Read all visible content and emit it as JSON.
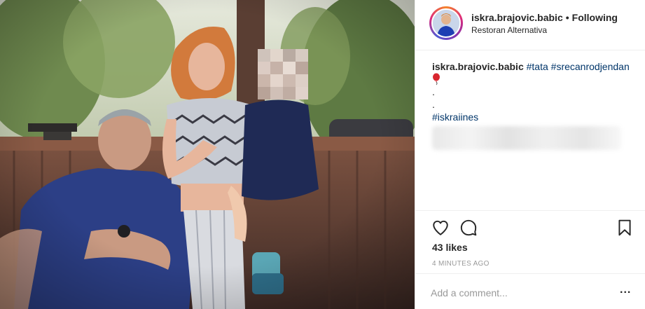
{
  "post": {
    "username": "iskra.brajovic.babic",
    "separator": "•",
    "follow_status": "Following",
    "location": "Restoran Alternativa"
  },
  "caption": {
    "username": "iskra.brajovic.babic",
    "hashtag_1": "#tata",
    "hashtag_2": "#srecanrodjendan",
    "emoji_icon": "balloon-icon",
    "dot_1": ".",
    "dot_2": ".",
    "hashtag_3": "#iskraiines"
  },
  "actions": {
    "like_icon": "heart-icon",
    "comment_icon": "speech-bubble-icon",
    "save_icon": "bookmark-icon"
  },
  "likes_text": "43 likes",
  "timestamp": "4 MINUTES AGO",
  "comment": {
    "placeholder": "Add a comment...",
    "more_label": "..."
  },
  "colors": {
    "hashtag": "#003569",
    "muted": "#999999",
    "text": "#262626",
    "divider": "#efefef"
  }
}
